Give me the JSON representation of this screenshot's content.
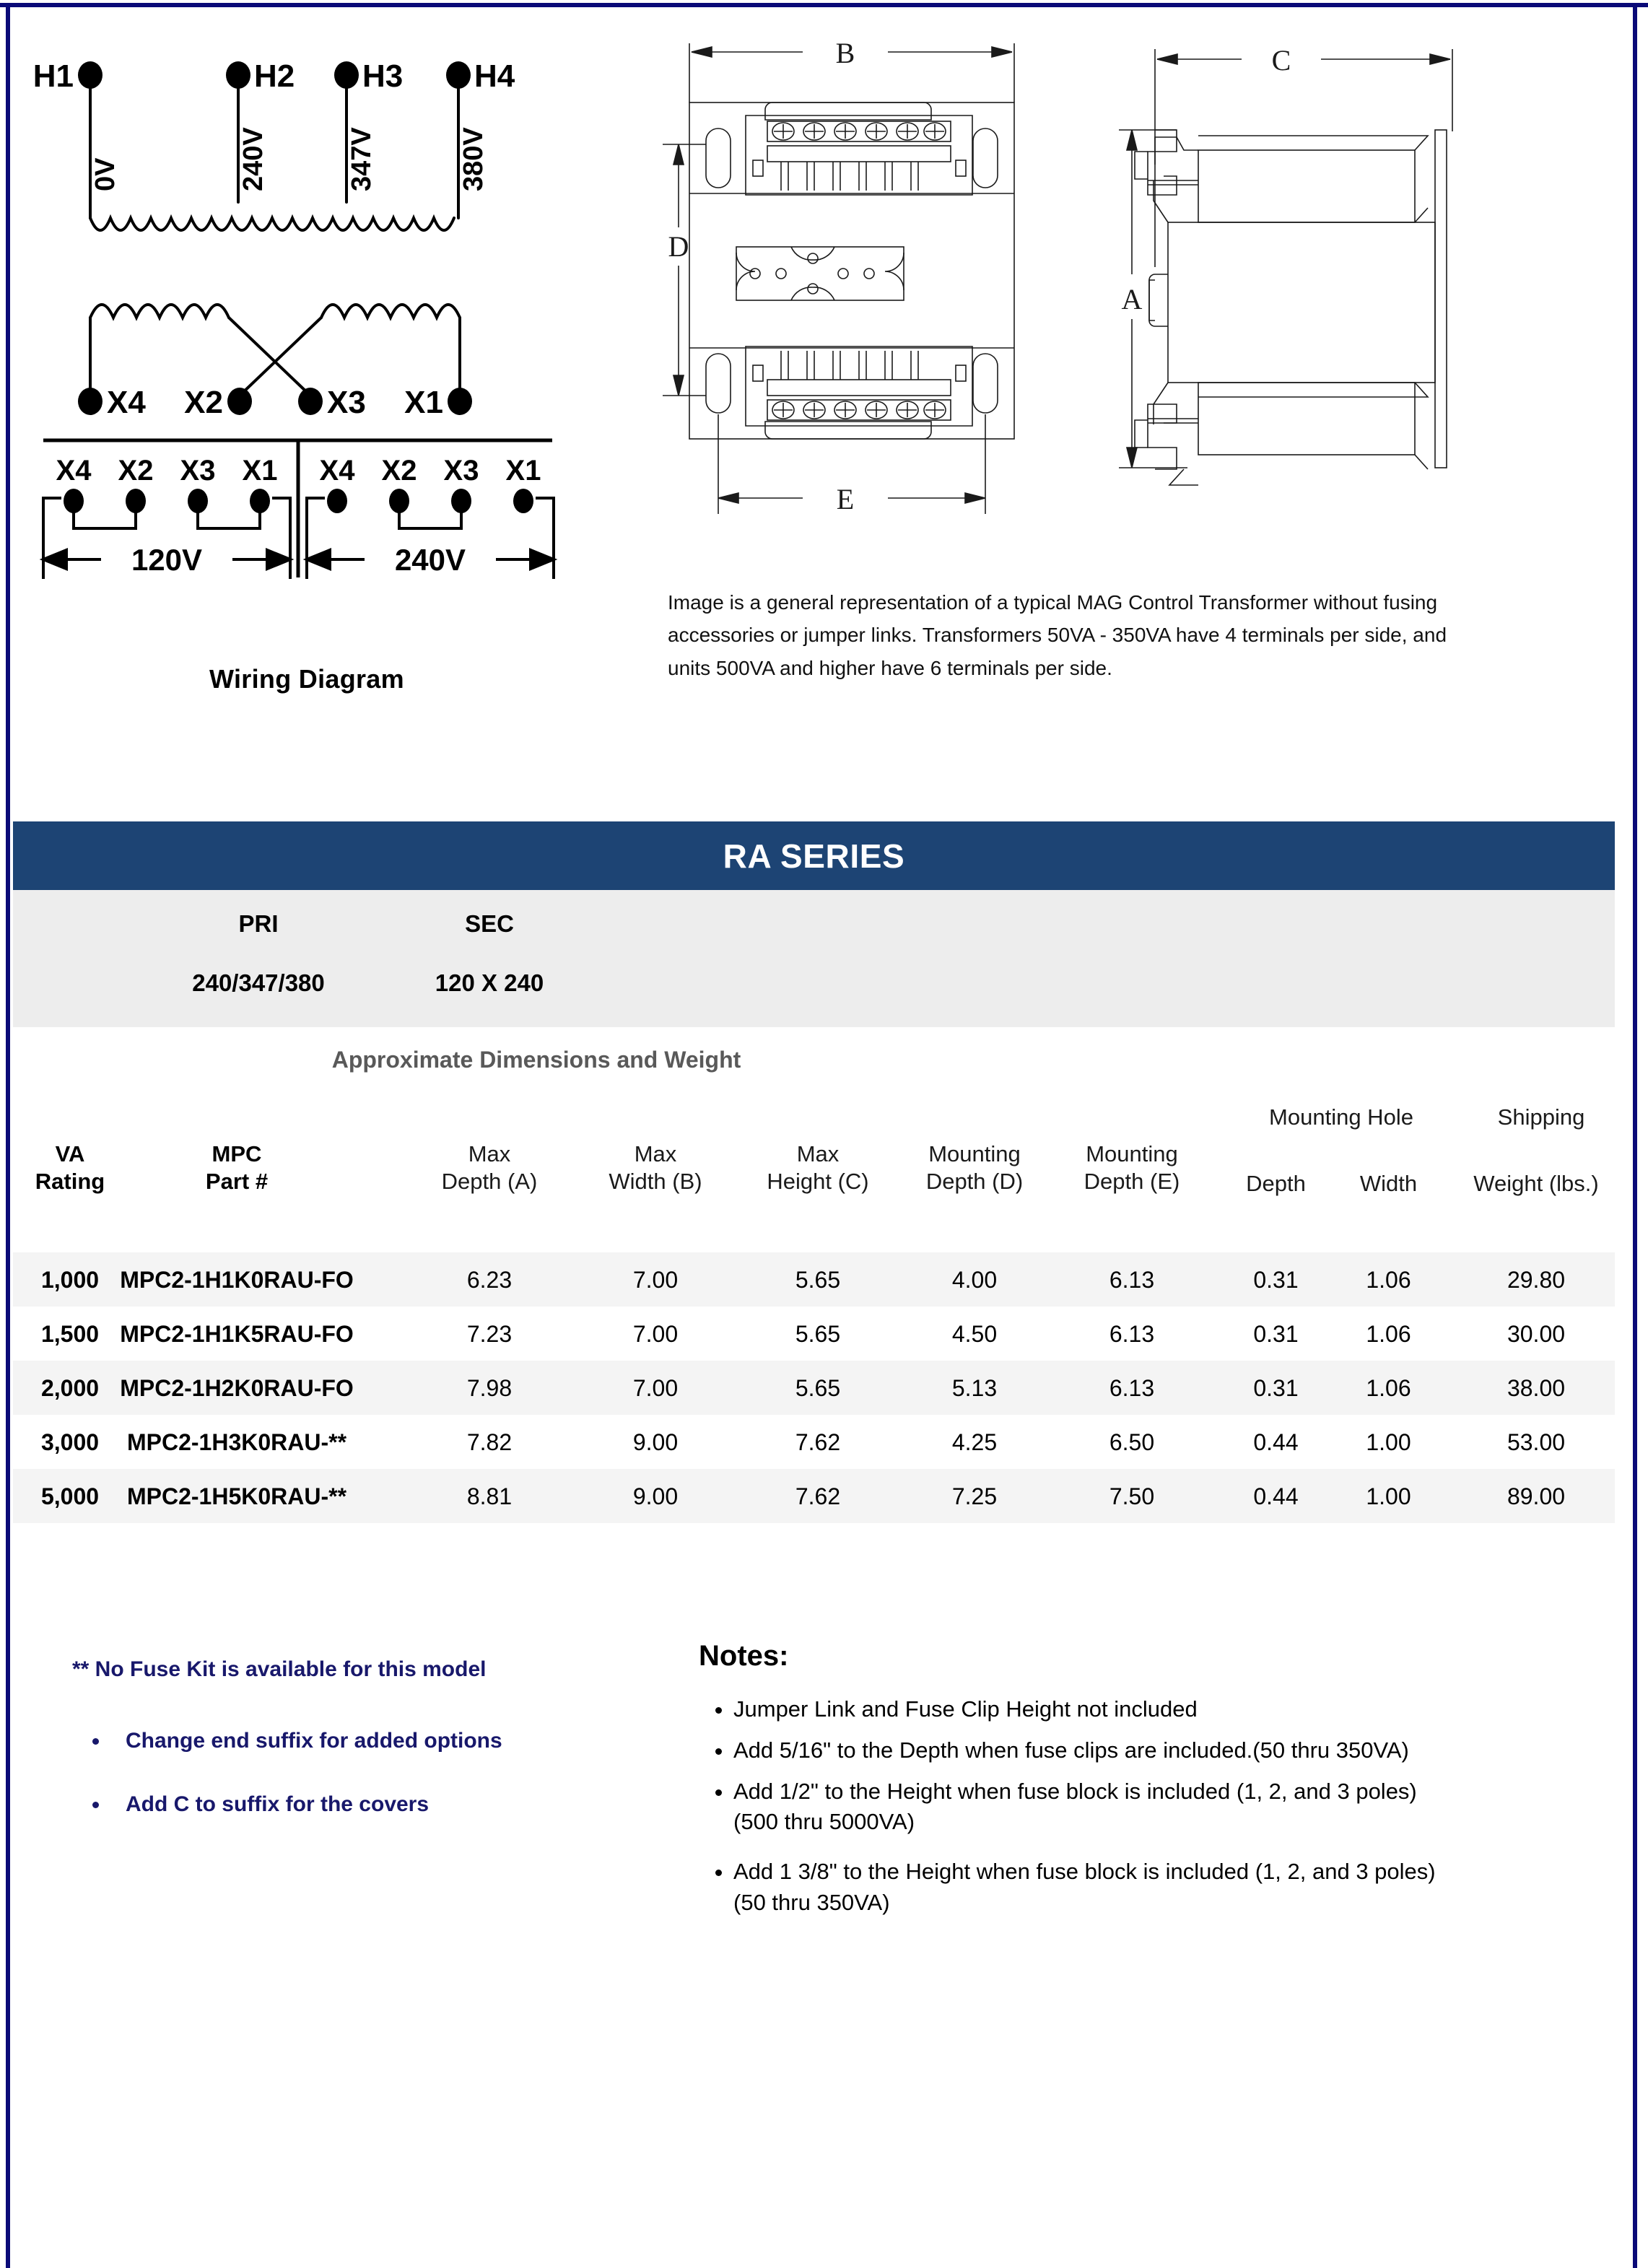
{
  "wiring": {
    "title": "Wiring Diagram",
    "primary_terminals": [
      "H1",
      "H2",
      "H3",
      "H4"
    ],
    "primary_taps": [
      "0V",
      "240V",
      "347V",
      "380V"
    ],
    "secondary_terminals": [
      "X4",
      "X2",
      "X3",
      "X1"
    ],
    "connection_groups": [
      {
        "terminals": [
          "X4",
          "X2",
          "X3",
          "X1"
        ],
        "voltage": "120V"
      },
      {
        "terminals": [
          "X4",
          "X2",
          "X3",
          "X1"
        ],
        "voltage": "240V"
      }
    ]
  },
  "mechanical": {
    "dimension_labels": [
      "B",
      "D",
      "E",
      "C",
      "A"
    ],
    "caption": "Image is a general representation of a typical MAG Control Transformer without fusing accessories or jumper links.  Transformers 50VA - 350VA  have 4 terminals per side, and units 500VA and higher have 6 terminals per side."
  },
  "banner": {
    "title": "RA SERIES",
    "color": "#1d4474"
  },
  "voltage_band": {
    "pri_label": "PRI",
    "sec_label": "SEC",
    "pri_value": "240/347/380",
    "sec_value": "120 X 240",
    "background": "#ededed"
  },
  "table": {
    "subtitle": "Approximate Dimensions and Weight",
    "group_headers": [
      {
        "label": "Mounting Hole"
      },
      {
        "label": "Shipping"
      }
    ],
    "columns": [
      {
        "line1": "VA",
        "line2": "Rating",
        "bold": true
      },
      {
        "line1": "MPC",
        "line2": "Part #",
        "bold": true
      },
      {
        "line1": "Max",
        "line2": "Depth (A)",
        "bold": false
      },
      {
        "line1": "Max",
        "line2": "Width (B)",
        "bold": false
      },
      {
        "line1": "Max",
        "line2": "Height (C)",
        "bold": false
      },
      {
        "line1": "Mounting",
        "line2": "Depth (D)",
        "bold": false
      },
      {
        "line1": "Mounting",
        "line2": "Depth (E)",
        "bold": false
      },
      {
        "line1": "",
        "line2": "Depth",
        "bold": false
      },
      {
        "line1": "",
        "line2": "Width",
        "bold": false
      },
      {
        "line1": "",
        "line2": "Weight (lbs.)",
        "bold": false
      }
    ],
    "rows": [
      [
        "1,000",
        "MPC2-1H1K0RAU-FO",
        "6.23",
        "7.00",
        "5.65",
        "4.00",
        "6.13",
        "0.31",
        "1.06",
        "29.80"
      ],
      [
        "1,500",
        "MPC2-1H1K5RAU-FO",
        "7.23",
        "7.00",
        "5.65",
        "4.50",
        "6.13",
        "0.31",
        "1.06",
        "30.00"
      ],
      [
        "2,000",
        "MPC2-1H2K0RAU-FO",
        "7.98",
        "7.00",
        "5.65",
        "5.13",
        "6.13",
        "0.31",
        "1.06",
        "38.00"
      ],
      [
        "3,000",
        "MPC2-1H3K0RAU-**",
        "7.82",
        "9.00",
        "7.62",
        "4.25",
        "6.50",
        "0.44",
        "1.00",
        "53.00"
      ],
      [
        "5,000",
        "MPC2-1H5K0RAU-**",
        "8.81",
        "9.00",
        "7.62",
        "7.25",
        "7.50",
        "0.44",
        "1.00",
        "89.00"
      ]
    ]
  },
  "footnotes": {
    "color": "#18186b",
    "lead": "** No Fuse Kit is available for this model",
    "items": [
      "Change end suffix for added options",
      "Add C to suffix for the covers"
    ]
  },
  "notes": {
    "title": "Notes:",
    "items": [
      "Jumper Link and Fuse Clip Height not included",
      "Add 5/16\" to the Depth when fuse clips are included.(50 thru 350VA)",
      "Add 1/2\" to the Height when fuse block is included (1, 2, and 3 poles)",
      "(500 thru 5000VA)",
      "Add 1 3/8\" to the Height when fuse block is included (1, 2, and 3 poles)",
      "(50 thru 350VA)"
    ]
  }
}
